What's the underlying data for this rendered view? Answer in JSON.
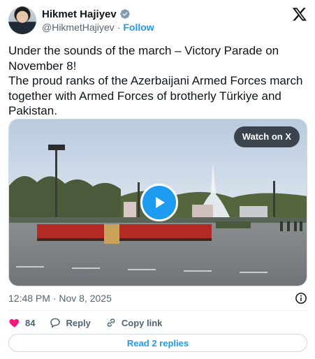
{
  "author": {
    "display_name": "Hikmet Hajiyev",
    "handle": "@HikmetHajiyev",
    "separator": "·",
    "follow_label": "Follow",
    "verified_icon": "verified-badge-icon"
  },
  "brand": {
    "logo": "x-logo-icon"
  },
  "tweet": {
    "text_lines": [
      "Under the sounds of the march – Victory Parade on November 8!",
      "The proud ranks of the Azerbaijani Armed Forces march together with Armed Forces of brotherly Türkiye and Pakistan."
    ]
  },
  "media": {
    "watch_label": "Watch on X",
    "play_icon": "play-icon"
  },
  "meta": {
    "timestamp": "12:48 PM · Nov 8, 2025",
    "info_icon": "info-icon"
  },
  "actions": {
    "like_count": "84",
    "reply_label": "Reply",
    "copy_link_label": "Copy link"
  },
  "replies": {
    "label": "Read 2 replies"
  },
  "colors": {
    "accent": "#1d9bf0",
    "like": "#f91880",
    "secondary_text": "#536471",
    "border": "#cfd9de"
  }
}
